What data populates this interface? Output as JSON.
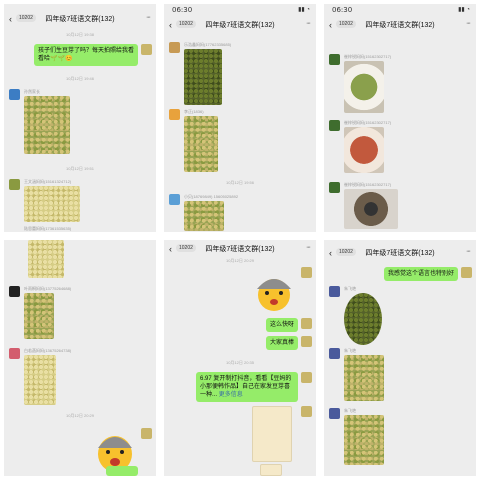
{
  "colors": {
    "bubble": "#95ec69",
    "chat_bg": "#ededed",
    "meta": "#9a9a9a"
  },
  "p1": {
    "badge": "10202",
    "title": "四年级7班语文群(132)",
    "ts1": "10月12日 19:38",
    "msg1": "孩子们生豆芽了吗？每天拍照给我看看哈🌱🌱😊",
    "ts2": "10月12日 19:46",
    "name1": "孙然家长",
    "ts3": "10月12日 19:51",
    "name2": "王文涵妈妈(15161324712)",
    "name3": "陆思蕾妈妈(17361535635)"
  },
  "p2": {
    "time": "06:30",
    "badge": "10202",
    "title": "四年级7班语文群(132)",
    "name1": "乐浩鑫妈妈(17762335685)",
    "name2": "李正(1836)",
    "ts1": "10月12日 19:56",
    "name3": "小贝(18769849) 15605025892"
  },
  "p3": {
    "time": "06:30",
    "badge": "10202",
    "title": "四年级7班语文群(132)",
    "name1": "崔梓锐妈妈(15162302717)",
    "name2": "崔梓锐妈妈(15162302717)",
    "name3": "崔梓锐妈妈(15162302717)"
  },
  "p4": {
    "name1": "叶雨桐妈妈(13775264688)",
    "name2": "白若菡妈妈(13675264738)",
    "ts1": "10月12日 20:29"
  },
  "p5": {
    "badge": "10202",
    "title": "四年级7班语文群(132)",
    "ts1": "10月12日 20:29",
    "msg1": "这么快呀",
    "msg2": "大家真棒",
    "ts2": "10月12日 20:35",
    "msg3": "6.97 复开制打抖音，看看【豆妈的小那便韩作品】自己在家发豆芽喜一种...",
    "msg3_more": "更多信息"
  },
  "p6": {
    "badge": "10202",
    "title": "四年级7班语文群(132)",
    "msg1": "我感觉这个语言也特别好",
    "name1": "朱飞艳",
    "name2": "朱飞艳",
    "name3": "朱飞艳"
  }
}
